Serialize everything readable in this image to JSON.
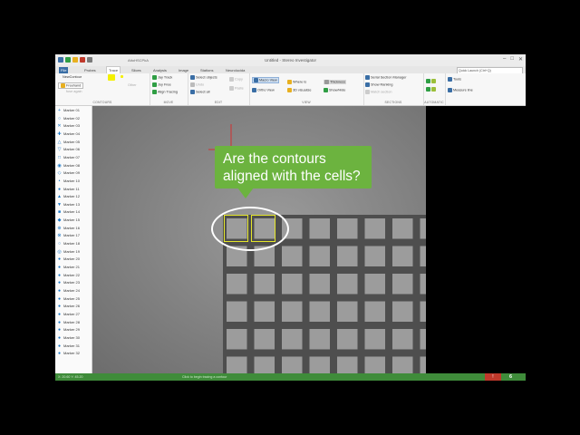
{
  "window": {
    "title": "Untitled - Stereo Investigator",
    "project": "AttoHSCPkA",
    "controls": [
      "–",
      "□",
      "✕"
    ]
  },
  "quick_access": {
    "colors": [
      "#3a6ea5",
      "#2f9e44",
      "#e8b020",
      "#c0392b",
      "#7a7a7a"
    ]
  },
  "menu": {
    "tabs": [
      "File",
      "Probes",
      "Trace",
      "Slices",
      "Analysis",
      "Image",
      "Stations",
      "Neurolucida"
    ],
    "active_tab": "Trace",
    "quick_launch": "Quick Launch (Ctrl+Q)"
  },
  "ribbon": {
    "contours": {
      "label": "CONTOURS",
      "new_contour": "NewContour",
      "type": "Freehand",
      "item_label": "fuse again",
      "item_other": "Other"
    },
    "move": {
      "label": "MOVE",
      "items": [
        "Jay Track",
        "Joy Free",
        "Align Tracing"
      ]
    },
    "edit": {
      "label": "EDIT",
      "items": [
        "Select objects",
        "Undo",
        "Select all"
      ],
      "items_right": [
        "Copy",
        "Paste"
      ]
    },
    "view": {
      "label": "VIEW",
      "col1": [
        "Macro View",
        "Ortho View"
      ],
      "col2": [
        "Where Is",
        "3D visualize"
      ],
      "col3": [
        "Thickness",
        "Show/Hide"
      ]
    },
    "sections": {
      "label": "SECTIONS",
      "items": [
        "Serial Section Manager",
        "Show Ranking",
        "Match section"
      ]
    },
    "automatic": {
      "label": "AUTOMATIC"
    },
    "tools": {
      "items": [
        "Tools",
        "Measure line"
      ]
    }
  },
  "markers": [
    {
      "label": "Marker 01",
      "sym": "+"
    },
    {
      "label": "Marker 02",
      "sym": "○"
    },
    {
      "label": "Marker 03",
      "sym": "✕"
    },
    {
      "label": "Marker 04",
      "sym": "✚"
    },
    {
      "label": "Marker 05",
      "sym": "△"
    },
    {
      "label": "Marker 06",
      "sym": "▽"
    },
    {
      "label": "Marker 07",
      "sym": "□"
    },
    {
      "label": "Marker 08",
      "sym": "◉"
    },
    {
      "label": "Marker 09",
      "sym": "◇"
    },
    {
      "label": "Marker 10",
      "sym": "•"
    },
    {
      "label": "Marker 11",
      "sym": "●"
    },
    {
      "label": "Marker 12",
      "sym": "▲"
    },
    {
      "label": "Marker 13",
      "sym": "▼"
    },
    {
      "label": "Marker 14",
      "sym": "■"
    },
    {
      "label": "Marker 15",
      "sym": "◆"
    },
    {
      "label": "Marker 16",
      "sym": "⊕"
    },
    {
      "label": "Marker 17",
      "sym": "⊗"
    },
    {
      "label": "Marker 18",
      "sym": "○"
    },
    {
      "label": "Marker 19",
      "sym": "◎"
    },
    {
      "label": "Marker 20",
      "sym": "●"
    },
    {
      "label": "Marker 21",
      "sym": "●"
    },
    {
      "label": "Marker 22",
      "sym": "●"
    },
    {
      "label": "Marker 23",
      "sym": "●"
    },
    {
      "label": "Marker 24",
      "sym": "●"
    },
    {
      "label": "Marker 25",
      "sym": "●"
    },
    {
      "label": "Marker 26",
      "sym": "●"
    },
    {
      "label": "Marker 27",
      "sym": "●"
    },
    {
      "label": "Marker 28",
      "sym": "●"
    },
    {
      "label": "Marker 29",
      "sym": "●"
    },
    {
      "label": "Marker 30",
      "sym": "●"
    },
    {
      "label": "Marker 31",
      "sym": "●"
    },
    {
      "label": "Marker 32",
      "sym": "●"
    }
  ],
  "callout": {
    "line1": "Are the contours",
    "line2": "aligned with the cells?",
    "color": "#6cb33f"
  },
  "contour_color": "#e5e62a",
  "status": {
    "left": "X: 20.60  Y: 45.20",
    "center": "Click to begin tracing a contour",
    "error_badge": "!",
    "count": "6"
  }
}
